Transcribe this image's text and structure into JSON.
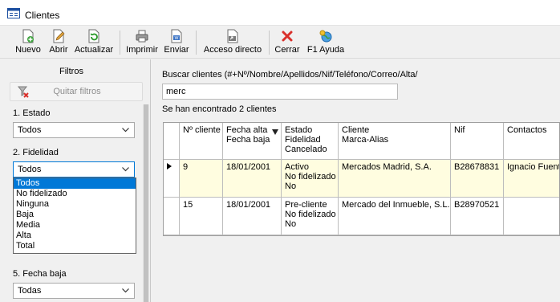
{
  "window": {
    "title": "Clientes"
  },
  "toolbar": {
    "nuevo": "Nuevo",
    "abrir": "Abrir",
    "actualizar": "Actualizar",
    "imprimir": "Imprimir",
    "enviar": "Enviar",
    "acceso_directo": "Acceso directo",
    "cerrar": "Cerrar",
    "ayuda": "F1 Ayuda"
  },
  "filters": {
    "title": "Filtros",
    "quitar_label": "Quitar filtros",
    "estado_label": "1. Estado",
    "estado_value": "Todos",
    "fidelidad_label": "2. Fidelidad",
    "fidelidad_value": "Todos",
    "fidelidad_options": [
      "Todos",
      "No fidelizado",
      "Ninguna",
      "Baja",
      "Media",
      "Alta",
      "Total"
    ],
    "fecha_baja_label": "5. Fecha baja",
    "fecha_baja_value": "Todas"
  },
  "search": {
    "label": "Buscar clientes (#+Nº/Nombre/Apellidos/Nif/Teléfono/Correo/Alta/",
    "value": "merc",
    "result_text": "Se han encontrado 2 clientes"
  },
  "grid": {
    "headers": {
      "num": "Nº cliente",
      "fecha_1": "Fecha alta",
      "fecha_2": "Fecha baja",
      "estado_1": "Estado",
      "estado_2": "Fidelidad",
      "estado_3": "Cancelado",
      "cliente_1": "Cliente",
      "cliente_2": "Marca-Alias",
      "nif": "Nif",
      "contactos": "Contactos"
    },
    "rows": [
      {
        "num": "9",
        "fecha": "18/01/2001",
        "estado": "Activo",
        "fidelidad": "No fidelizado",
        "cancelado": "No",
        "cliente": "Mercados Madrid, S.A.",
        "nif": "B28678831",
        "contactos": "Ignacio Fuentes"
      },
      {
        "num": "15",
        "fecha": "18/01/2001",
        "estado": "Pre-cliente",
        "fidelidad": "No fidelizado",
        "cancelado": "No",
        "cliente": "Mercado del Inmueble, S.L.",
        "nif": "B28970521",
        "contactos": ""
      }
    ]
  },
  "colors": {
    "selection": "#0078d7",
    "row_highlight": "#fffde0",
    "current_cell": "#b2c1d6"
  }
}
